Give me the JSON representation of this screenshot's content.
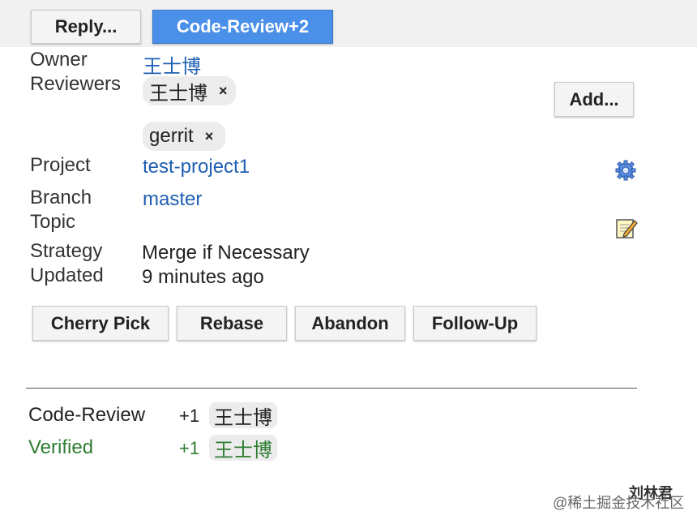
{
  "actions": {
    "reply": "Reply...",
    "code_review_plus2": "Code-Review+2"
  },
  "info": {
    "owner_label": "Owner",
    "owner_value": "王士博",
    "reviewers_label": "Reviewers",
    "reviewers": [
      {
        "name": "王士博",
        "remove": "×"
      },
      {
        "name": "gerrit",
        "remove": "×"
      }
    ],
    "add_reviewer": "Add...",
    "project_label": "Project",
    "project_value": "test-project1",
    "branch_label": "Branch",
    "branch_value": "master",
    "topic_label": "Topic",
    "strategy_label": "Strategy",
    "strategy_value": "Merge if Necessary",
    "updated_label": "Updated",
    "updated_value": "9 minutes ago"
  },
  "change_actions": {
    "cherry_pick": "Cherry Pick",
    "rebase": "Rebase",
    "abandon": "Abandon",
    "follow_up": "Follow-Up"
  },
  "votes": [
    {
      "label": "Code-Review",
      "value": "+1",
      "user": "王士博",
      "color": "#222222"
    },
    {
      "label": "Verified",
      "value": "+1",
      "user": "王士博",
      "color": "#2e7d32"
    }
  ],
  "watermark": {
    "line1": "刘林君",
    "line2": "@稀土掘金技术社区"
  },
  "colors": {
    "link": "#1f5fb3",
    "primary": "#4a8fe8",
    "verified": "#2e7d32"
  },
  "icons": {
    "project_settings": "gear-icon",
    "topic_edit": "edit-icon"
  }
}
